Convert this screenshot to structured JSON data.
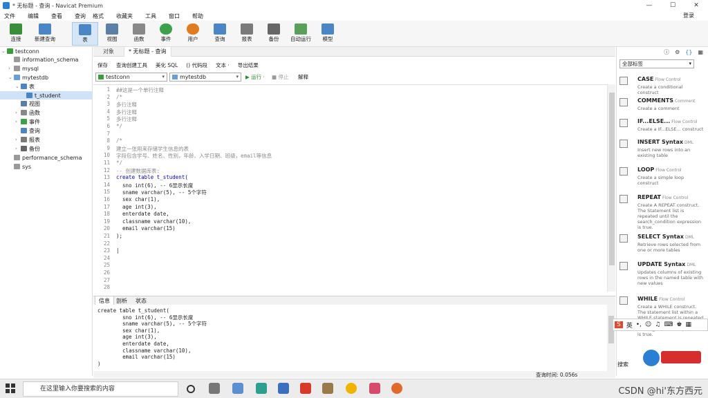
{
  "window": {
    "title": "* 无标题 - 查询 - Navicat Premium",
    "min": "—",
    "max": "☐",
    "close": "✕"
  },
  "menu": {
    "items": [
      "文件",
      "编辑",
      "查看",
      "查询",
      "格式",
      "收藏夹",
      "工具",
      "窗口",
      "帮助"
    ],
    "login": "登录"
  },
  "toolbar": {
    "buttons": [
      "连接",
      "新建查询",
      "表",
      "视图",
      "函数",
      "事件",
      "用户",
      "查询",
      "报表",
      "备份",
      "自动运行",
      "模型"
    ],
    "selected": "表"
  },
  "nav": {
    "items": [
      {
        "label": "testconn",
        "level": 0,
        "arrow": "⌄",
        "icon": "conn"
      },
      {
        "label": "information_schema",
        "level": 1,
        "arrow": "",
        "icon": "db"
      },
      {
        "label": "mysql",
        "level": 1,
        "arrow": "›",
        "icon": "db"
      },
      {
        "label": "mytestdb",
        "level": 1,
        "arrow": "⌄",
        "icon": "db"
      },
      {
        "label": "表",
        "level": 2,
        "arrow": "⌄",
        "icon": "table"
      },
      {
        "label": "t_student",
        "level": 3,
        "arrow": "",
        "icon": "table",
        "selected": true
      },
      {
        "label": "视图",
        "level": 2,
        "arrow": "",
        "icon": "view"
      },
      {
        "label": "函数",
        "level": 2,
        "arrow": "›",
        "icon": "func"
      },
      {
        "label": "事件",
        "level": 2,
        "arrow": "›",
        "icon": "event"
      },
      {
        "label": "查询",
        "level": 2,
        "arrow": "",
        "icon": "query"
      },
      {
        "label": "报表",
        "level": 2,
        "arrow": "›",
        "icon": "report"
      },
      {
        "label": "备份",
        "level": 2,
        "arrow": "›",
        "icon": "backup"
      },
      {
        "label": "performance_schema",
        "level": 1,
        "arrow": "",
        "icon": "db"
      },
      {
        "label": "sys",
        "level": 1,
        "arrow": "",
        "icon": "db"
      }
    ]
  },
  "tabs": [
    {
      "label": "对象",
      "active": false
    },
    {
      "label": "* 无标题 - 查询",
      "active": true
    }
  ],
  "editor_toolbar": [
    "保存",
    "查询创建工具",
    "美化 SQL",
    "() 代码段",
    "文本 ·",
    "导出结果"
  ],
  "connection_select": "testconn",
  "database_select": "mytestdb",
  "run_bar": {
    "run": "▶ 运行 ·",
    "stop": "■ 停止",
    "explain": "解释"
  },
  "code_lines": [
    {
      "n": "1",
      "t": "##这是一个单行注释",
      "c": "com"
    },
    {
      "n": "2",
      "t": "/*",
      "c": "com"
    },
    {
      "n": "3",
      "t": "多行注释",
      "c": "com"
    },
    {
      "n": "4",
      "t": "多行注释",
      "c": "com"
    },
    {
      "n": "5",
      "t": "多行注释",
      "c": "com"
    },
    {
      "n": "6",
      "t": "*/",
      "c": "com"
    },
    {
      "n": "7",
      "t": "",
      "c": "tx"
    },
    {
      "n": "8",
      "t": "/*",
      "c": "com"
    },
    {
      "n": "9",
      "t": "建立一张用来存储学生信息的表",
      "c": "com"
    },
    {
      "n": "10",
      "t": "字段包含学号、姓名、性别，年龄、入学日期、班级，email等信息",
      "c": "com"
    },
    {
      "n": "11",
      "t": "*/",
      "c": "com"
    },
    {
      "n": "12",
      "t": "-- 创建数据库表:",
      "c": "com"
    },
    {
      "n": "13",
      "t": "create table t_student(",
      "c": "kw"
    },
    {
      "n": "14",
      "t": "  sno int(6), -- 6显示长度",
      "c": "tx"
    },
    {
      "n": "15",
      "t": "  sname varchar(5), -- 5个字符",
      "c": "tx"
    },
    {
      "n": "16",
      "t": "  sex char(1),",
      "c": "tx"
    },
    {
      "n": "17",
      "t": "  age int(3),",
      "c": "tx"
    },
    {
      "n": "18",
      "t": "  enterdate date,",
      "c": "tx"
    },
    {
      "n": "19",
      "t": "  classname varchar(10),",
      "c": "tx"
    },
    {
      "n": "20",
      "t": "  email varchar(15)",
      "c": "tx"
    },
    {
      "n": "21",
      "t": ");",
      "c": "tx"
    },
    {
      "n": "22",
      "t": "",
      "c": "tx"
    },
    {
      "n": "23",
      "t": "|",
      "c": "tx"
    },
    {
      "n": "24",
      "t": "",
      "c": "tx"
    },
    {
      "n": "25",
      "t": "",
      "c": "tx"
    },
    {
      "n": "26",
      "t": "",
      "c": "tx"
    },
    {
      "n": "27",
      "t": "",
      "c": "tx"
    },
    {
      "n": "28",
      "t": "",
      "c": "tx"
    }
  ],
  "bottom_tabs": [
    {
      "label": "信息",
      "active": true
    },
    {
      "label": "剖析",
      "active": false
    },
    {
      "label": "状态",
      "active": false
    }
  ],
  "info_text": "create table t_student(\n        sno int(6), -- 6显示长度\n        sname varchar(5), -- 5个字符\n        sex char(1),\n        age int(3),\n        enterdate date,\n        classname varchar(10),\n        email varchar(15)\n)",
  "status": {
    "query_time": "查询时间: 0.056s"
  },
  "right_panel": {
    "filter": "全部标签",
    "snippets": [
      {
        "title": "CASE",
        "tag": "Flow Control",
        "desc": "Create a conditional construct"
      },
      {
        "title": "COMMENTS",
        "tag": "Comment",
        "desc": "Create a comment"
      },
      {
        "title": "IF...ELSE...",
        "tag": "Flow Control",
        "desc": "Create a IF...ELSE... construct"
      },
      {
        "title": "INSERT Syntax",
        "tag": "DML",
        "desc": "Insert new rows into an existing table"
      },
      {
        "title": "LOOP",
        "tag": "Flow Control",
        "desc": "Create a simple loop construct"
      },
      {
        "title": "REPEAT",
        "tag": "Flow Control",
        "desc": "Create A REPEAT construct. The Statement list is repeated until the search_condition expression is true."
      },
      {
        "title": "SELECT Syntax",
        "tag": "DML",
        "desc": "Retrieve rows selected from one or more tables"
      },
      {
        "title": "UPDATE Syntax",
        "tag": "DML",
        "desc": "Updates columns of existing rows in the named table with new values"
      },
      {
        "title": "WHILE",
        "tag": "Flow Control",
        "desc": "Create a WHILE construct. The statement list within a WHILE statement is repeated as long as the search_condition expression is true."
      }
    ],
    "search_label": "搜索",
    "ime_label": "英"
  },
  "taskbar": {
    "search_placeholder": "在这里输入你要搜索的内容",
    "watermark": "CSDN @hi'东方西元"
  },
  "colors": {
    "accent": "#2a7fd3",
    "keyword": "#0000d0",
    "comment": "#8a8a8a",
    "selection": "#cfe2f6"
  }
}
